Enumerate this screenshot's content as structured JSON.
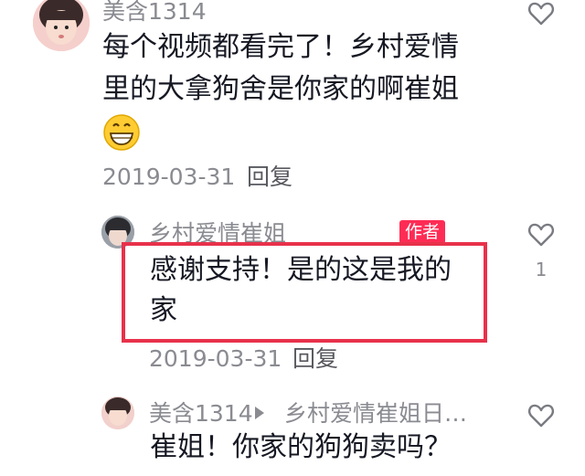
{
  "comments": [
    {
      "username": "美含1314",
      "text_line1": "每个视频都看完了！乡村爱情",
      "text_line2": "里的大拿狗舍是你家的啊崔姐",
      "emoji": "grinning-face",
      "date": "2019-03-31",
      "reply_label": "回复"
    },
    {
      "username": "乡村爱情崔姐",
      "author_tag": "作者",
      "text_line1": "感谢支持！是的这是我的",
      "text_line2": "家",
      "date": "2019-03-31",
      "reply_label": "回复",
      "like_count": "1"
    },
    {
      "username": "美含1314",
      "reply_to": "乡村爱情崔姐日…",
      "text_line1": "崔姐！你家的狗狗卖吗？"
    }
  ],
  "colors": {
    "highlight": "#e8314b",
    "author_tag": "#fe2c55",
    "meta_text": "#8a8b91"
  }
}
